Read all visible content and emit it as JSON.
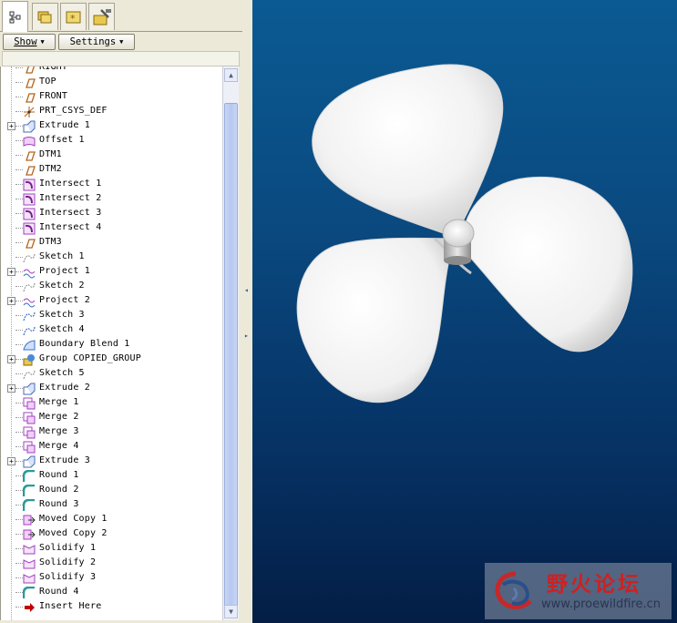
{
  "tabs": [
    {
      "name": "model-tree-tab",
      "icon": "model-tree-icon"
    },
    {
      "name": "folder-browser-tab",
      "icon": "folders-icon"
    },
    {
      "name": "favorites-tab",
      "icon": "favorites-icon"
    },
    {
      "name": "connections-tab",
      "icon": "tools-icon"
    }
  ],
  "toolbar": {
    "show_label": "Show",
    "settings_label": "Settings"
  },
  "tree": {
    "items": [
      {
        "label": "RIGHT",
        "icon": "datum-plane-icon",
        "expandable": false
      },
      {
        "label": "TOP",
        "icon": "datum-plane-icon",
        "expandable": false
      },
      {
        "label": "FRONT",
        "icon": "datum-plane-icon",
        "expandable": false
      },
      {
        "label": "PRT_CSYS_DEF",
        "icon": "coordinate-system-icon",
        "expandable": false
      },
      {
        "label": "Extrude 1",
        "icon": "extrude-icon",
        "expandable": true
      },
      {
        "label": "Offset 1",
        "icon": "offset-icon",
        "expandable": false
      },
      {
        "label": "DTM1",
        "icon": "datum-plane-icon",
        "expandable": false
      },
      {
        "label": "DTM2",
        "icon": "datum-plane-icon",
        "expandable": false
      },
      {
        "label": "Intersect 1",
        "icon": "intersect-icon",
        "expandable": false
      },
      {
        "label": "Intersect 2",
        "icon": "intersect-icon",
        "expandable": false
      },
      {
        "label": "Intersect 3",
        "icon": "intersect-icon",
        "expandable": false
      },
      {
        "label": "Intersect 4",
        "icon": "intersect-icon",
        "expandable": false
      },
      {
        "label": "DTM3",
        "icon": "datum-plane-icon",
        "expandable": false
      },
      {
        "label": "Sketch 1",
        "icon": "sketch-icon",
        "expandable": false
      },
      {
        "label": "Project 1",
        "icon": "project-icon",
        "expandable": true
      },
      {
        "label": "Sketch 2",
        "icon": "sketch-icon",
        "expandable": false
      },
      {
        "label": "Project 2",
        "icon": "project-icon",
        "expandable": true
      },
      {
        "label": "Sketch 3",
        "icon": "sketch-blue-icon",
        "expandable": false
      },
      {
        "label": "Sketch 4",
        "icon": "sketch-blue-icon",
        "expandable": false
      },
      {
        "label": "Boundary Blend 1",
        "icon": "boundary-blend-icon",
        "expandable": false
      },
      {
        "label": "Group COPIED_GROUP",
        "icon": "group-icon",
        "expandable": true
      },
      {
        "label": "Sketch 5",
        "icon": "sketch-icon",
        "expandable": false
      },
      {
        "label": "Extrude 2",
        "icon": "extrude-icon",
        "expandable": true
      },
      {
        "label": "Merge 1",
        "icon": "merge-icon",
        "expandable": false
      },
      {
        "label": "Merge 2",
        "icon": "merge-icon",
        "expandable": false
      },
      {
        "label": "Merge 3",
        "icon": "merge-icon",
        "expandable": false
      },
      {
        "label": "Merge 4",
        "icon": "merge-icon",
        "expandable": false
      },
      {
        "label": "Extrude 3",
        "icon": "extrude-icon",
        "expandable": true
      },
      {
        "label": "Round 1",
        "icon": "round-icon",
        "expandable": false
      },
      {
        "label": "Round 2",
        "icon": "round-icon",
        "expandable": false
      },
      {
        "label": "Round 3",
        "icon": "round-icon",
        "expandable": false
      },
      {
        "label": "Moved Copy 1",
        "icon": "moved-copy-icon",
        "expandable": false
      },
      {
        "label": "Moved Copy 2",
        "icon": "moved-copy-icon",
        "expandable": false
      },
      {
        "label": "Solidify 1",
        "icon": "solidify-icon",
        "expandable": false
      },
      {
        "label": "Solidify 2",
        "icon": "solidify-icon",
        "expandable": false
      },
      {
        "label": "Solidify 3",
        "icon": "solidify-icon",
        "expandable": false
      },
      {
        "label": "Round 4",
        "icon": "round-icon",
        "expandable": false
      },
      {
        "label": "Insert Here",
        "icon": "insert-here-arrow-icon",
        "expandable": false
      }
    ]
  },
  "viewport": {
    "model": "three-blade propeller",
    "background_top": "#0b5a93",
    "background_bottom": "#041e45"
  },
  "watermark": {
    "title": "野火论坛",
    "url": "www.proewildfire.cn"
  },
  "colors": {
    "datum_plane": "#b5651d",
    "feature_purple": "#a040c0",
    "feature_teal": "#2a9a9a",
    "insert_arrow": "#c00000"
  }
}
